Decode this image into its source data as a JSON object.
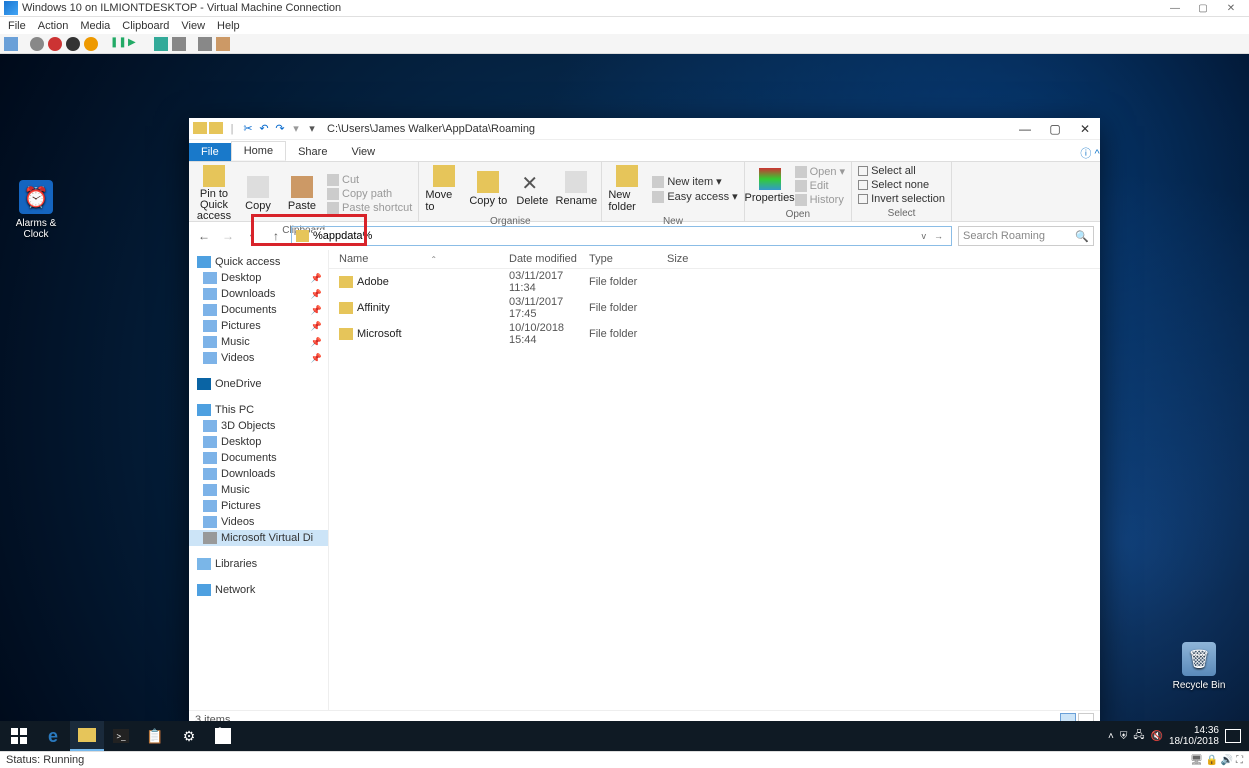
{
  "host": {
    "title": "Windows 10 on ILMIONTDESKTOP - Virtual Machine Connection",
    "menu": [
      "File",
      "Action",
      "Media",
      "Clipboard",
      "View",
      "Help"
    ],
    "status": "Status: Running"
  },
  "desktop_icons": {
    "alarms": "Alarms &\nClock",
    "recycle": "Recycle Bin"
  },
  "taskbar": {
    "time": "14:36",
    "date": "18/10/2018"
  },
  "explorer": {
    "title_path": "C:\\Users\\James Walker\\AppData\\Roaming",
    "tabs": {
      "file": "File",
      "home": "Home",
      "share": "Share",
      "view": "View"
    },
    "ribbon": {
      "pin": "Pin to Quick access",
      "copy": "Copy",
      "paste": "Paste",
      "cut": "Cut",
      "copypath": "Copy path",
      "pasteshort": "Paste shortcut",
      "clipboard": "Clipboard",
      "moveto": "Move to",
      "copyto": "Copy to",
      "delete": "Delete",
      "rename": "Rename",
      "organise": "Organise",
      "newfolder": "New folder",
      "newitem": "New item",
      "easyaccess": "Easy access",
      "new": "New",
      "properties": "Properties",
      "open": "Open",
      "edit": "Edit",
      "history": "History",
      "open_grp": "Open",
      "selectall": "Select all",
      "selectnone": "Select none",
      "invert": "Invert selection",
      "select": "Select"
    },
    "address_value": "%appdata%",
    "search_placeholder": "Search Roaming",
    "columns": {
      "name": "Name",
      "date": "Date modified",
      "type": "Type",
      "size": "Size"
    },
    "rows": [
      {
        "name": "Adobe",
        "date": "03/11/2017 11:34",
        "type": "File folder"
      },
      {
        "name": "Affinity",
        "date": "03/11/2017 17:45",
        "type": "File folder"
      },
      {
        "name": "Microsoft",
        "date": "10/10/2018 15:44",
        "type": "File folder"
      }
    ],
    "sidebar": {
      "quick": "Quick access",
      "quick_items": [
        "Desktop",
        "Downloads",
        "Documents",
        "Pictures",
        "Music",
        "Videos"
      ],
      "onedrive": "OneDrive",
      "thispc": "This PC",
      "pc_items": [
        "3D Objects",
        "Desktop",
        "Documents",
        "Downloads",
        "Music",
        "Pictures",
        "Videos",
        "Microsoft Virtual Di"
      ],
      "libraries": "Libraries",
      "network": "Network"
    },
    "status": "3 items"
  }
}
